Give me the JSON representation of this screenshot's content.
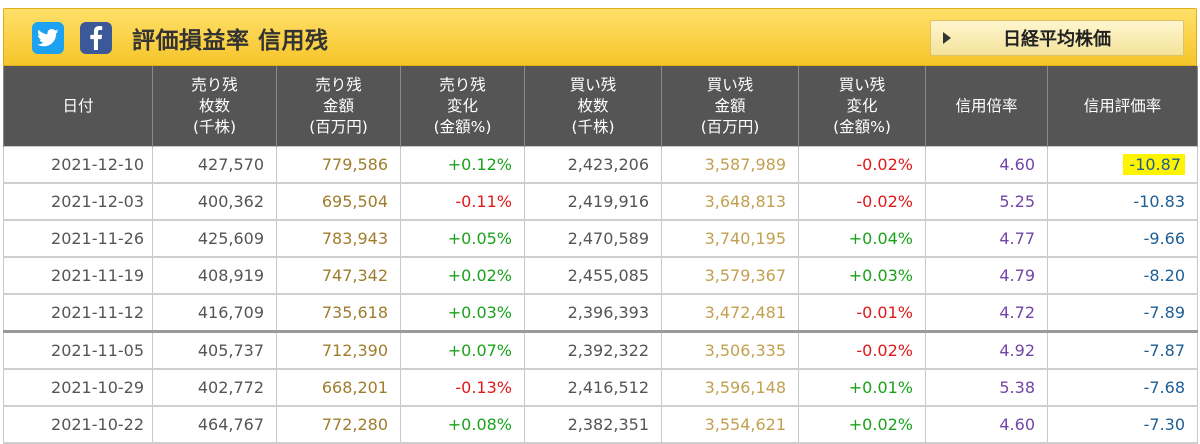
{
  "header": {
    "title": "評価損益率 信用残",
    "nikkei_button": "日経平均株価",
    "twitter_icon": "twitter-icon",
    "facebook_icon": "facebook-icon"
  },
  "table": {
    "columns": [
      [
        "日付"
      ],
      [
        "売り残",
        "枚数",
        "(千株)"
      ],
      [
        "売り残",
        "金額",
        "(百万円)"
      ],
      [
        "売り残",
        "変化",
        "(金額%)"
      ],
      [
        "買い残",
        "枚数",
        "(千株)"
      ],
      [
        "買い残",
        "金額",
        "(百万円)"
      ],
      [
        "買い残",
        "変化",
        "(金額%)"
      ],
      [
        "信用倍率"
      ],
      [
        "信用評価率"
      ]
    ],
    "rows": [
      [
        "2021-12-10",
        "427,570",
        "779,586",
        "+0.12%",
        "2,423,206",
        "3,587,989",
        "-0.02%",
        "4.60",
        "-10.87"
      ],
      [
        "2021-12-03",
        "400,362",
        "695,504",
        "-0.11%",
        "2,419,916",
        "3,648,813",
        "-0.02%",
        "5.25",
        "-10.83"
      ],
      [
        "2021-11-26",
        "425,609",
        "783,943",
        "+0.05%",
        "2,470,589",
        "3,740,195",
        "+0.04%",
        "4.77",
        "-9.66"
      ],
      [
        "2021-11-19",
        "408,919",
        "747,342",
        "+0.02%",
        "2,455,085",
        "3,579,367",
        "+0.03%",
        "4.79",
        "-8.20"
      ],
      [
        "2021-11-12",
        "416,709",
        "735,618",
        "+0.03%",
        "2,396,393",
        "3,472,481",
        "-0.01%",
        "4.72",
        "-7.89"
      ],
      [
        "2021-11-05",
        "405,737",
        "712,390",
        "+0.07%",
        "2,392,322",
        "3,506,335",
        "-0.02%",
        "4.92",
        "-7.87"
      ],
      [
        "2021-10-29",
        "402,772",
        "668,201",
        "-0.13%",
        "2,416,512",
        "3,596,148",
        "+0.01%",
        "5.38",
        "-7.68"
      ],
      [
        "2021-10-22",
        "464,767",
        "772,280",
        "+0.08%",
        "2,382,351",
        "3,554,621",
        "+0.02%",
        "4.60",
        "-7.30"
      ]
    ]
  },
  "colors": {
    "header_bg": "#f6c52a",
    "table_header_bg": "#555555",
    "positive": "#1aa31a",
    "negative": "#e01818",
    "ratio": "#7345a8",
    "eval": "#1c5e96",
    "amount": "#a07d2e",
    "highlight": "#fff400"
  }
}
